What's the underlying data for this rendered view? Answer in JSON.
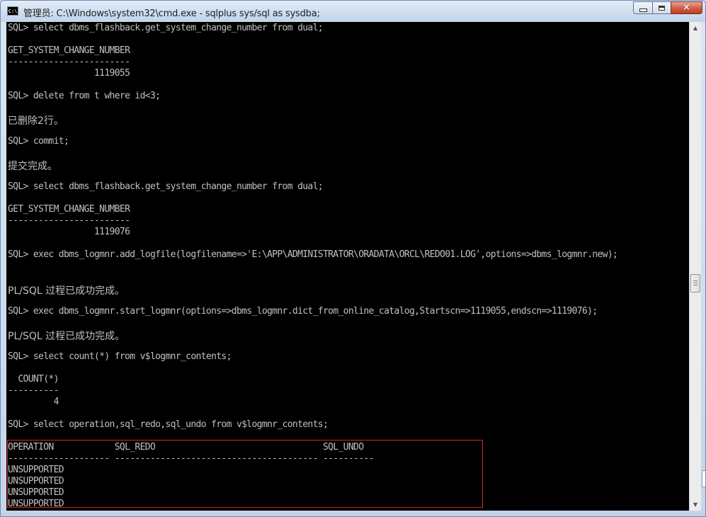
{
  "window": {
    "title": "管理员: C:\\Windows\\system32\\cmd.exe - sqlplus  sys/sql as sysdba;",
    "icon_label": "C:\\",
    "icon": "cmd-icon",
    "buttons": {
      "minimize": "minimize-icon",
      "maximize": "maximize-icon",
      "close": "×"
    }
  },
  "console": {
    "lines": [
      "SQL> select dbms_flashback.get_system_change_number from dual;",
      "",
      "GET_SYSTEM_CHANGE_NUMBER",
      "------------------------",
      "                 1119055",
      "",
      "SQL> delete from t where id<3;",
      "",
      "已删除2行。",
      "",
      "SQL> commit;",
      "",
      "提交完成。",
      "",
      "SQL> select dbms_flashback.get_system_change_number from dual;",
      "",
      "GET_SYSTEM_CHANGE_NUMBER",
      "------------------------",
      "                 1119076",
      "",
      "SQL> exec dbms_logmnr.add_logfile(logfilename=>'E:\\APP\\ADMINISTRATOR\\ORADATA\\ORCL\\REDO01.LOG',options=>dbms_logmnr.new);",
      "",
      "",
      "PL/SQL 过程已成功完成。",
      "",
      "SQL> exec dbms_logmnr.start_logmnr(options=>dbms_logmnr.dict_from_online_catalog,Startscn=>1119055,endscn=>1119076);",
      "",
      "PL/SQL 过程已成功完成。",
      "",
      "SQL> select count(*) from v$logmnr_contents;",
      "",
      "  COUNT(*)",
      "----------",
      "         4",
      "",
      "SQL> select operation,sql_redo,sql_undo from v$logmnr_contents;",
      "",
      "OPERATION            SQL_REDO                                 SQL_UNDO",
      "-------------------- ---------------------------------------- ----------",
      "UNSUPPORTED",
      "UNSUPPORTED",
      "UNSUPPORTED",
      "UNSUPPORTED"
    ]
  },
  "colors": {
    "console_background": "#000000",
    "console_text": "#c0c0c0",
    "highlight_border": "#d8262b"
  }
}
